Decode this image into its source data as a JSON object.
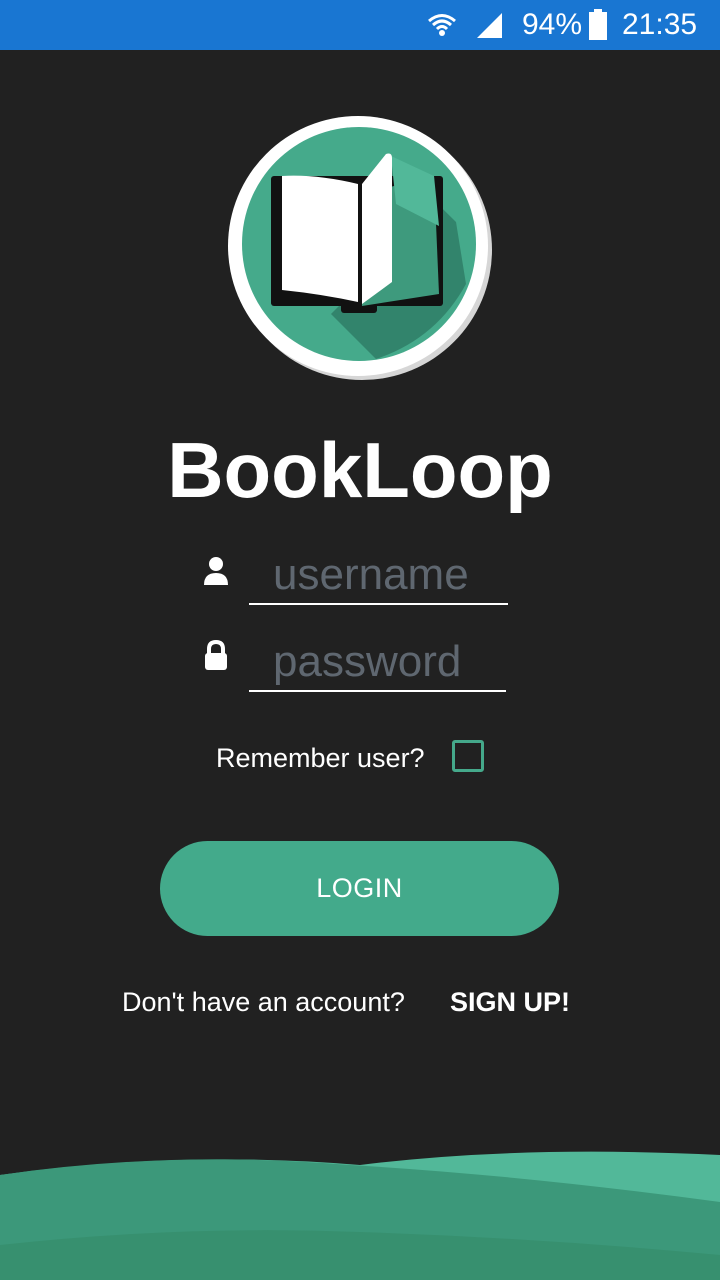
{
  "status_bar": {
    "battery_percent": "94%",
    "time": "21:35",
    "icons": [
      "wifi-icon",
      "signal-icon",
      "battery-icon"
    ]
  },
  "app": {
    "title": "BookLoop",
    "logo_icon": "book-icon"
  },
  "form": {
    "username_placeholder": "username",
    "password_placeholder": "password",
    "username_value": "",
    "password_value": "",
    "remember_label": "Remember user?",
    "remember_checked": false,
    "login_label": "LOGIN"
  },
  "footer": {
    "signup_prompt": "Don't have an account?",
    "signup_label": "SIGN UP!"
  },
  "colors": {
    "status_bar": "#1976D2",
    "background": "#212121",
    "accent": "#43AA8B",
    "accent_light": "#52B899",
    "placeholder": "#5F6770"
  }
}
